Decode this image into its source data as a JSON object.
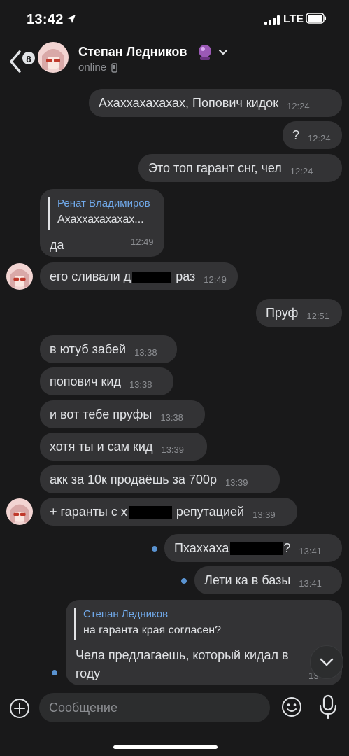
{
  "status_bar": {
    "time": "13:42",
    "network": "LTE"
  },
  "header": {
    "unread_count": "8",
    "contact_name": "Степан Ледников",
    "contact_emoji": "🔮",
    "status": "online"
  },
  "messages": [
    {
      "text": "Ахаххахахахах, Попович кидок",
      "time": "12:24"
    },
    {
      "text": "?",
      "time": "12:24"
    },
    {
      "text": "Это топ гарант снг, чел",
      "time": "12:24"
    },
    {
      "reply_author": "Ренат Владимиров",
      "reply_text": "Ахаххахахахах...",
      "text": "да",
      "time": "12:49"
    },
    {
      "text": "его сливали д",
      "text_after": "раз",
      "time": "12:49"
    },
    {
      "text": "Пруф",
      "time": "12:51"
    },
    {
      "text": "в ютуб забей",
      "time": "13:38"
    },
    {
      "text": "попович кид",
      "time": "13:38"
    },
    {
      "text": "и вот тебе пруфы",
      "time": "13:38"
    },
    {
      "text": "хотя ты и сам кид",
      "time": "13:39"
    },
    {
      "text": "акк за 10к продаёшь за 700р",
      "time": "13:39"
    },
    {
      "text": "+ гаранты с х",
      "text_after": "репутацией",
      "time": "13:39"
    },
    {
      "text": "Пхаххаха",
      "text_after": "?",
      "time": "13:41"
    },
    {
      "text": "Лети ка в базы",
      "time": "13:41"
    },
    {
      "reply_author": "Степан Ледников",
      "reply_text": "на гаранта края согласен?",
      "text_line1": "Чела предлагаешь, который кидал в",
      "text_line2": "году",
      "time": "13"
    }
  ],
  "input": {
    "placeholder": "Сообщение"
  },
  "colors": {
    "background": "#19191a",
    "bubble": "#333335",
    "accent": "#71aaeb",
    "unread_dot": "#5a93d1"
  }
}
